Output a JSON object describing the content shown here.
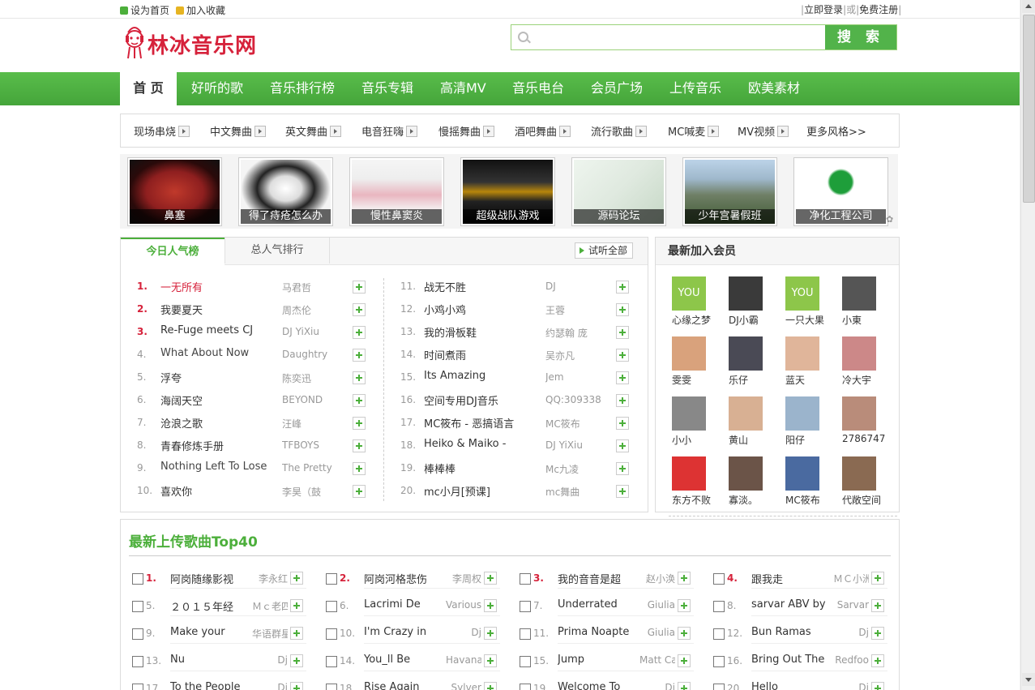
{
  "topbar": {
    "set_home": "设为首页",
    "add_fav": "加入收藏",
    "login": "立即登录",
    "or": "或",
    "register": "免费注册"
  },
  "logo": {
    "text": "林冰音乐网"
  },
  "search": {
    "placeholder": "",
    "button": "搜 索"
  },
  "nav": [
    "首 页",
    "好听的歌",
    "音乐排行榜",
    "音乐专辑",
    "高清MV",
    "音乐电台",
    "会员广场",
    "上传音乐",
    "欧美素材"
  ],
  "subnav": [
    "现场串烧",
    "中文舞曲",
    "英文舞曲",
    "电音狂嗨",
    "慢摇舞曲",
    "酒吧舞曲",
    "流行歌曲",
    "MC喊麦",
    "MV视频",
    "更多风格>>"
  ],
  "strip": [
    "鼻塞",
    "得了痔疮怎么办",
    "慢性鼻窦炎",
    "超级战队游戏",
    "源码论坛",
    "少年宫暑假班",
    "净化工程公司"
  ],
  "chart": {
    "tab_today": "今日人气榜",
    "tab_total": "总人气排行",
    "listen_all": "试听全部",
    "left": [
      {
        "n": "1.",
        "t": "一无所有",
        "a": "马君哲"
      },
      {
        "n": "2.",
        "t": "我要夏天",
        "a": "周杰伦"
      },
      {
        "n": "3.",
        "t": "Re-Fuge meets CJ",
        "a": "DJ YiXiu"
      },
      {
        "n": "4.",
        "t": "What About Now",
        "a": "Daughtry"
      },
      {
        "n": "5.",
        "t": "浮夸",
        "a": "陈奕迅"
      },
      {
        "n": "6.",
        "t": "海阔天空",
        "a": "BEYOND"
      },
      {
        "n": "7.",
        "t": "沧浪之歌",
        "a": "汪峰"
      },
      {
        "n": "8.",
        "t": "青春修炼手册",
        "a": "TFBOYS"
      },
      {
        "n": "9.",
        "t": "Nothing Left To Lose",
        "a": "The Pretty"
      },
      {
        "n": "10.",
        "t": "喜欢你",
        "a": "李昊（鼓"
      }
    ],
    "right": [
      {
        "n": "11.",
        "t": "战无不胜",
        "a": "DJ"
      },
      {
        "n": "12.",
        "t": "小鸡小鸡",
        "a": "王蓉"
      },
      {
        "n": "13.",
        "t": "我的滑板鞋",
        "a": "约瑟翰 庞"
      },
      {
        "n": "14.",
        "t": "时间煮雨",
        "a": "吴亦凡"
      },
      {
        "n": "15.",
        "t": "Its Amazing",
        "a": "Jem"
      },
      {
        "n": "16.",
        "t": "空间专用DJ音乐",
        "a": "QQ:309338"
      },
      {
        "n": "17.",
        "t": "MC筱布 - 恶搞语言",
        "a": "MC筱布"
      },
      {
        "n": "18.",
        "t": "Heiko & Maiko -",
        "a": "DJ YiXiu"
      },
      {
        "n": "19.",
        "t": "棒棒棒",
        "a": "Mc九凌"
      },
      {
        "n": "20.",
        "t": "mc小月[预课]",
        "a": "mc舞曲"
      }
    ]
  },
  "members": {
    "title": "最新加入会员",
    "list": [
      {
        "name": "心缘之梦",
        "you": "YOU",
        "color": "#8dc64a"
      },
      {
        "name": "DJ小霸",
        "color": "#3a3a3a"
      },
      {
        "name": "一只大果",
        "you": "YOU",
        "color": "#8dc64a"
      },
      {
        "name": "小東",
        "color": "#555"
      },
      {
        "name": "雯雯",
        "color": "#d9a27c"
      },
      {
        "name": "乐仔",
        "color": "#4a4a55"
      },
      {
        "name": "蓝天",
        "color": "#e0b59a"
      },
      {
        "name": "冷大宇",
        "color": "#c88"
      },
      {
        "name": "小小",
        "color": "#888"
      },
      {
        "name": "黄山",
        "color": "#d8b093"
      },
      {
        "name": "阳仔",
        "color": "#9bb4cc"
      },
      {
        "name": "2786747",
        "color": "#b98c7a"
      },
      {
        "name": "东方不败",
        "color": "#d33"
      },
      {
        "name": "寡淡。",
        "color": "#6b5448"
      },
      {
        "name": "MC筱布",
        "color": "#4a6aa0"
      },
      {
        "name": "代敞空间",
        "color": "#8a6a52"
      }
    ]
  },
  "top40": {
    "title": "最新上传歌曲Top40",
    "rows": [
      {
        "n": "1.",
        "t": "阿岗随缘影视",
        "a": "李永红"
      },
      {
        "n": "2.",
        "t": "阿岗河格悲伤",
        "a": "李周权"
      },
      {
        "n": "3.",
        "t": "我的音音是超",
        "a": "赵小涣"
      },
      {
        "n": "4.",
        "t": "跟我走",
        "a": "ＭＣ小洲"
      },
      {
        "n": "5.",
        "t": "２０１５年经",
        "a": "Ｍｃ老四"
      },
      {
        "n": "6.",
        "t": "Lacrimi De",
        "a": "Various"
      },
      {
        "n": "7.",
        "t": "Underrated",
        "a": "Giulia"
      },
      {
        "n": "8.",
        "t": "sarvar ABV by",
        "a": "Sarvar"
      },
      {
        "n": "9.",
        "t": "Make your",
        "a": "华语群星"
      },
      {
        "n": "10.",
        "t": "I'm Crazy in",
        "a": "Dj"
      },
      {
        "n": "11.",
        "t": "Prima Noapte",
        "a": "Giulia"
      },
      {
        "n": "12.",
        "t": "Bun Ramas",
        "a": "Dj"
      },
      {
        "n": "13.",
        "t": "Nu",
        "a": "Dj"
      },
      {
        "n": "14.",
        "t": "You_ll Be",
        "a": "Havana"
      },
      {
        "n": "15.",
        "t": "Jump",
        "a": "Matt Cab"
      },
      {
        "n": "16.",
        "t": "Bring Out The",
        "a": "Redfoo"
      },
      {
        "n": "17.",
        "t": "To the People",
        "a": "Dj"
      },
      {
        "n": "18.",
        "t": "Rise Again",
        "a": "Sylver"
      },
      {
        "n": "19.",
        "t": "Welcome To",
        "a": "Dj"
      },
      {
        "n": "20.",
        "t": "Hello",
        "a": "Dj"
      }
    ]
  }
}
